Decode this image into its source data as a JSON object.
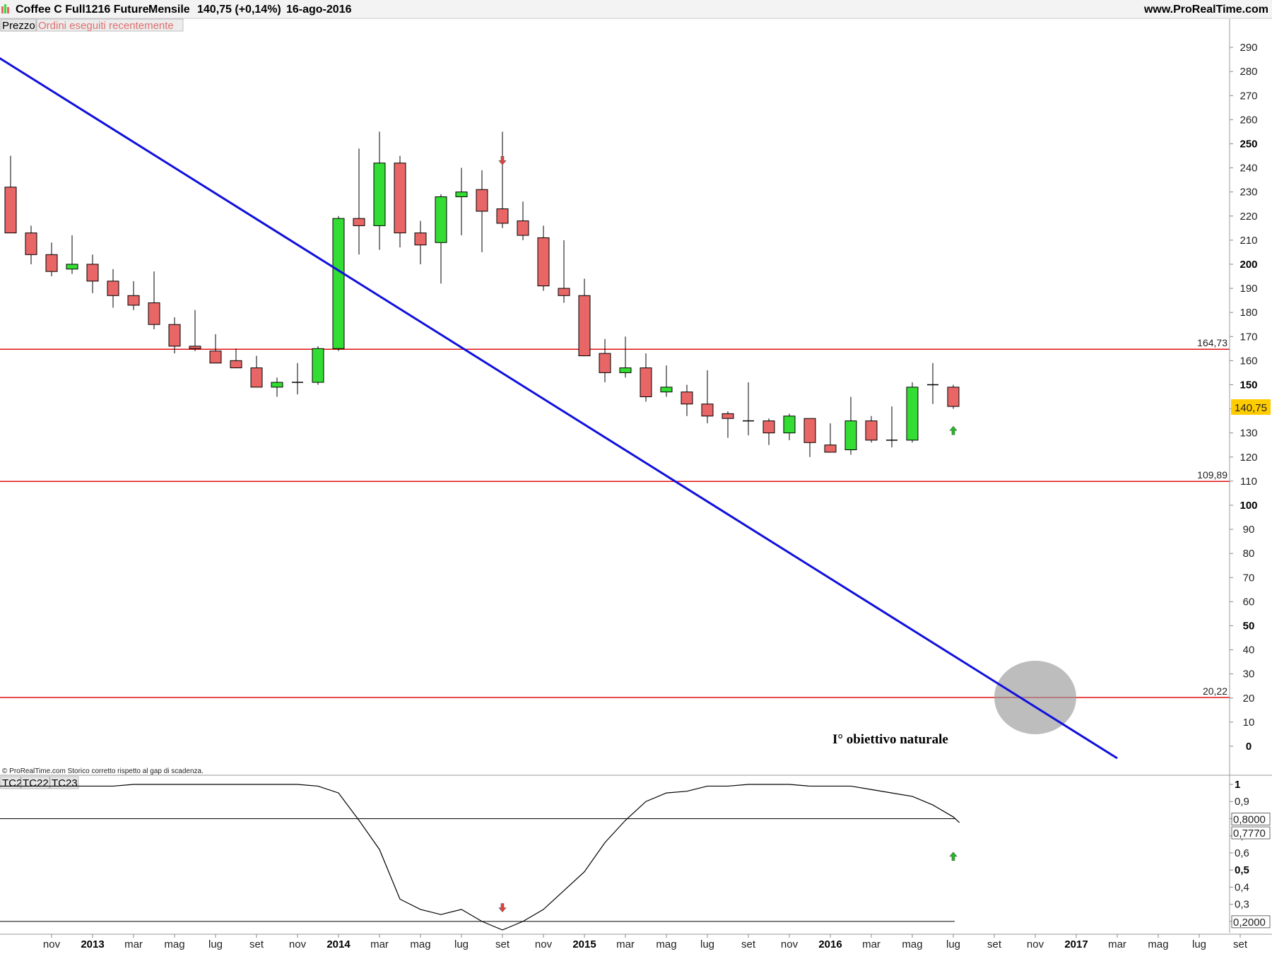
{
  "header": {
    "instrument": "Coffee C Full1216 Future",
    "period": "Mensile",
    "price": "140,75 (+0,14%)",
    "date": "16-ago-2016",
    "site": "www.ProRealTime.com"
  },
  "tabs": {
    "prezzo": "Prezzo",
    "ordini": "Ordini eseguiti recentemente"
  },
  "footer_note": "© ProRealTime.com  Storico corretto rispetto al gap di scadenza.",
  "indicator_tabs": [
    "TC2",
    "TC22",
    "TC23"
  ],
  "colors": {
    "bull": "#33dd33",
    "bear": "#e86666",
    "hline": "#e01010",
    "trend": "#1010dd",
    "price_tag": "#ffcc00"
  },
  "annotation": "I° obiettivo naturale",
  "chart_data": [
    {
      "type": "candlestick",
      "title": "Coffee C Full1216 Future",
      "ylim": [
        -5,
        295
      ],
      "yticks": [
        "290",
        "280",
        "270",
        "260",
        "250",
        "240",
        "230",
        "220",
        "210",
        "200",
        "190",
        "180",
        "170",
        "160",
        "150",
        "140",
        "130",
        "120",
        "110",
        "100",
        "90",
        "80",
        "70",
        "60",
        "50",
        "40",
        "30",
        "20",
        "10",
        "0"
      ],
      "bold_yticks": [
        "250",
        "200",
        "150",
        "100",
        "50",
        "0"
      ],
      "last_price_label": "140,75",
      "last_price": 140.75,
      "time_labels": [
        "nov",
        "2013",
        "mar",
        "mag",
        "lug",
        "set",
        "nov",
        "2014",
        "mar",
        "mag",
        "lug",
        "set",
        "nov",
        "2015",
        "mar",
        "mag",
        "lug",
        "set",
        "nov",
        "2016",
        "mar",
        "mag",
        "lug",
        "set",
        "nov",
        "2017",
        "mar",
        "mag",
        "lug",
        "set"
      ],
      "bold_time_labels": [
        "2013",
        "2014",
        "2015",
        "2016",
        "2017"
      ],
      "candles": [
        {
          "t": "2012-09",
          "o": 232,
          "h": 245,
          "l": 213,
          "c": 213
        },
        {
          "t": "2012-10",
          "o": 213,
          "h": 216,
          "l": 200,
          "c": 204
        },
        {
          "t": "2012-11",
          "o": 204,
          "h": 209,
          "l": 195,
          "c": 197
        },
        {
          "t": "2012-12",
          "o": 198,
          "h": 212,
          "l": 196,
          "c": 200
        },
        {
          "t": "2013-01",
          "o": 200,
          "h": 204,
          "l": 188,
          "c": 193
        },
        {
          "t": "2013-02",
          "o": 193,
          "h": 198,
          "l": 182,
          "c": 187
        },
        {
          "t": "2013-03",
          "o": 187,
          "h": 193,
          "l": 181,
          "c": 183
        },
        {
          "t": "2013-04",
          "o": 184,
          "h": 197,
          "l": 173,
          "c": 175
        },
        {
          "t": "2013-05",
          "o": 175,
          "h": 178,
          "l": 163,
          "c": 166
        },
        {
          "t": "2013-06",
          "o": 166,
          "h": 181,
          "l": 164,
          "c": 165
        },
        {
          "t": "2013-07",
          "o": 164,
          "h": 171,
          "l": 159,
          "c": 159
        },
        {
          "t": "2013-08",
          "o": 160,
          "h": 165,
          "l": 157,
          "c": 157
        },
        {
          "t": "2013-09",
          "o": 157,
          "h": 162,
          "l": 149,
          "c": 149
        },
        {
          "t": "2013-10",
          "o": 149,
          "h": 153,
          "l": 145,
          "c": 151
        },
        {
          "t": "2013-11",
          "o": 151,
          "h": 159,
          "l": 146,
          "c": 151
        },
        {
          "t": "2013-12",
          "o": 151,
          "h": 166,
          "l": 150,
          "c": 165
        },
        {
          "t": "2014-01",
          "o": 165,
          "h": 220,
          "l": 164,
          "c": 219
        },
        {
          "t": "2014-02",
          "o": 219,
          "h": 248,
          "l": 204,
          "c": 216
        },
        {
          "t": "2014-03",
          "o": 216,
          "h": 255,
          "l": 206,
          "c": 242
        },
        {
          "t": "2014-04",
          "o": 242,
          "h": 245,
          "l": 207,
          "c": 213
        },
        {
          "t": "2014-05",
          "o": 213,
          "h": 218,
          "l": 200,
          "c": 208
        },
        {
          "t": "2014-06",
          "o": 209,
          "h": 229,
          "l": 192,
          "c": 228
        },
        {
          "t": "2014-07",
          "o": 228,
          "h": 240,
          "l": 212,
          "c": 230
        },
        {
          "t": "2014-08",
          "o": 231,
          "h": 239,
          "l": 205,
          "c": 222
        },
        {
          "t": "2014-09",
          "o": 223,
          "h": 255,
          "l": 215,
          "c": 217
        },
        {
          "t": "2014-10",
          "o": 218,
          "h": 226,
          "l": 210,
          "c": 212
        },
        {
          "t": "2014-11",
          "o": 211,
          "h": 216,
          "l": 189,
          "c": 191
        },
        {
          "t": "2014-12",
          "o": 190,
          "h": 210,
          "l": 184,
          "c": 187
        },
        {
          "t": "2015-01",
          "o": 187,
          "h": 194,
          "l": 162,
          "c": 162
        },
        {
          "t": "2015-02",
          "o": 163,
          "h": 169,
          "l": 151,
          "c": 155
        },
        {
          "t": "2015-03",
          "o": 155,
          "h": 170,
          "l": 153,
          "c": 157
        },
        {
          "t": "2015-04",
          "o": 157,
          "h": 163,
          "l": 143,
          "c": 145
        },
        {
          "t": "2015-05",
          "o": 147,
          "h": 158,
          "l": 145,
          "c": 149
        },
        {
          "t": "2015-06",
          "o": 147,
          "h": 150,
          "l": 137,
          "c": 142
        },
        {
          "t": "2015-07",
          "o": 142,
          "h": 156,
          "l": 134,
          "c": 137
        },
        {
          "t": "2015-08",
          "o": 138,
          "h": 139,
          "l": 128,
          "c": 136
        },
        {
          "t": "2015-09",
          "o": 135,
          "h": 151,
          "l": 129,
          "c": 135
        },
        {
          "t": "2015-10",
          "o": 135,
          "h": 136,
          "l": 125,
          "c": 130
        },
        {
          "t": "2015-11",
          "o": 130,
          "h": 138,
          "l": 127,
          "c": 137
        },
        {
          "t": "2015-12",
          "o": 136,
          "h": 136,
          "l": 120,
          "c": 126
        },
        {
          "t": "2016-01",
          "o": 125,
          "h": 134,
          "l": 122,
          "c": 122
        },
        {
          "t": "2016-02",
          "o": 123,
          "h": 145,
          "l": 121,
          "c": 135
        },
        {
          "t": "2016-03",
          "o": 135,
          "h": 137,
          "l": 126,
          "c": 127
        },
        {
          "t": "2016-04",
          "o": 127,
          "h": 141,
          "l": 124,
          "c": 127
        },
        {
          "t": "2016-05",
          "o": 127,
          "h": 151,
          "l": 126,
          "c": 149
        },
        {
          "t": "2016-06",
          "o": 150,
          "h": 159,
          "l": 142,
          "c": 150
        },
        {
          "t": "2016-07",
          "o": 149,
          "h": 150,
          "l": 140,
          "c": 141
        }
      ],
      "horizontal_lines": [
        {
          "value": 164.73,
          "label": "164,73"
        },
        {
          "value": 109.89,
          "label": "109,89"
        },
        {
          "value": 20.22,
          "label": "20,22"
        }
      ],
      "trendline": {
        "from": {
          "t": "2012-08",
          "value": 288
        },
        "to": {
          "t": "2017-03",
          "value": -5
        }
      },
      "highlight_circle": {
        "t": "2016-11",
        "value": 20.22
      },
      "arrows": [
        {
          "t": "2014-09",
          "value": 243,
          "dir": "down"
        },
        {
          "t": "2016-07",
          "value": 131,
          "dir": "up"
        }
      ]
    },
    {
      "type": "line",
      "name": "TC2",
      "ylim": [
        0.15,
        1.0
      ],
      "yticks": [
        "1",
        "0,9",
        "0,8",
        "0,7",
        "0,6",
        "0,5",
        "0,4",
        "0,3",
        "0,2"
      ],
      "bold_yticks": [
        "1",
        "0,5"
      ],
      "level_labels": [
        {
          "value": 0.8,
          "label": "0,8000"
        },
        {
          "value": 0.2,
          "label": "0,2000"
        }
      ],
      "current_label": "0,7770",
      "current_value": 0.777,
      "x": [
        "2012-08",
        "2012-09",
        "2012-10",
        "2012-11",
        "2012-12",
        "2013-01",
        "2013-02",
        "2013-03",
        "2013-04",
        "2013-05",
        "2013-06",
        "2013-07",
        "2013-08",
        "2013-09",
        "2013-10",
        "2013-11",
        "2013-12",
        "2014-01",
        "2014-02",
        "2014-03",
        "2014-04",
        "2014-05",
        "2014-06",
        "2014-07",
        "2014-08",
        "2014-09",
        "2014-10",
        "2014-11",
        "2014-12",
        "2015-01",
        "2015-02",
        "2015-03",
        "2015-04",
        "2015-05",
        "2015-06",
        "2015-07",
        "2015-08",
        "2015-09",
        "2015-10",
        "2015-11",
        "2015-12",
        "2016-01",
        "2016-02",
        "2016-03",
        "2016-04",
        "2016-05",
        "2016-06",
        "2016-07"
      ],
      "values": [
        0.99,
        0.99,
        0.99,
        0.99,
        0.99,
        0.99,
        0.99,
        1.0,
        1.0,
        1.0,
        1.0,
        1.0,
        1.0,
        1.0,
        1.0,
        1.0,
        0.99,
        0.95,
        0.79,
        0.62,
        0.33,
        0.27,
        0.24,
        0.27,
        0.2,
        0.15,
        0.2,
        0.27,
        0.38,
        0.49,
        0.66,
        0.79,
        0.9,
        0.95,
        0.96,
        0.99,
        0.99,
        1.0,
        1.0,
        1.0,
        0.99,
        0.99,
        0.99,
        0.97,
        0.95,
        0.93,
        0.88,
        0.81,
        0.777
      ],
      "arrows": [
        {
          "t": "2014-09",
          "value": 0.28,
          "dir": "down"
        },
        {
          "t": "2016-07",
          "value": 0.58,
          "dir": "up"
        }
      ]
    }
  ]
}
